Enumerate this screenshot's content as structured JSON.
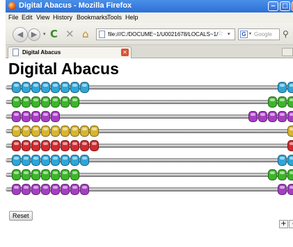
{
  "window": {
    "title": "Digital Abacus - Mozilla Firefox",
    "min_glyph": "‒",
    "max_glyph": "□",
    "close_glyph": "✕"
  },
  "menu": [
    {
      "label": "File"
    },
    {
      "label": "Edit"
    },
    {
      "label": "View"
    },
    {
      "label": "History"
    },
    {
      "label": "Bookmarks"
    },
    {
      "label": "Tools"
    },
    {
      "label": "Help"
    }
  ],
  "nav": {
    "back_glyph": "◀",
    "forward_glyph": "▶",
    "reload_glyph": "C",
    "stop_glyph": "✕",
    "home_glyph": "⌂",
    "url": "file:///C:/DOCUME~1/U0021678/LOCALS~1/",
    "star_glyph": "☆",
    "search_engine": "Google",
    "search_glyph": "⚲"
  },
  "tabs": [
    {
      "label": "Digital Abacus",
      "close_glyph": "✕"
    }
  ],
  "page": {
    "heading": "Digital Abacus",
    "reset_label": "Reset",
    "zoom_in_label": "+",
    "zoom_out_label": "-"
  },
  "abacus": {
    "colors": {
      "blue": "#2ea6d9",
      "green": "#3cb52a",
      "purple": "#a63ec4",
      "yellow": "#d9b52e",
      "red": "#d22a2f"
    },
    "rods": [
      {
        "color": "blue",
        "left_beads": 8,
        "right_beads": 2
      },
      {
        "color": "green",
        "left_beads": 7,
        "right_beads": 3
      },
      {
        "color": "purple",
        "left_beads": 5,
        "right_beads": 5
      },
      {
        "color": "yellow",
        "left_beads": 9,
        "right_beads": 1
      },
      {
        "color": "red",
        "left_beads": 9,
        "right_beads": 1
      },
      {
        "color": "blue",
        "left_beads": 8,
        "right_beads": 2
      },
      {
        "color": "green",
        "left_beads": 7,
        "right_beads": 3
      },
      {
        "color": "purple",
        "left_beads": 8,
        "right_beads": 2
      }
    ]
  }
}
